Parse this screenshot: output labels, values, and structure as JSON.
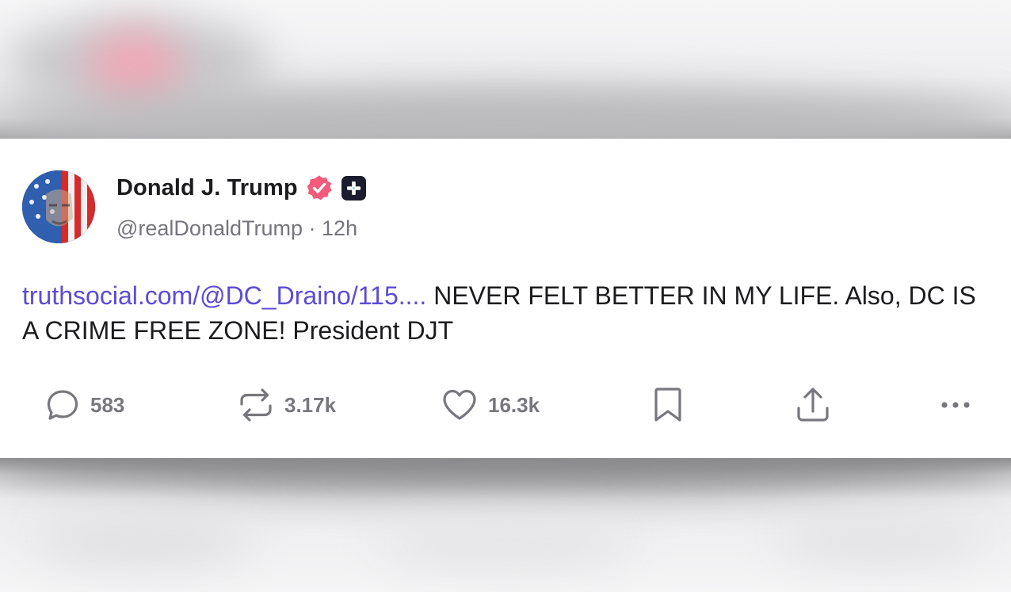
{
  "post": {
    "display_name": "Donald J. Trump",
    "handle": "@realDonaldTrump",
    "separator": "·",
    "time": "12h",
    "link_text": "truthsocial.com/@DC_Draino/115....",
    "body_text": " NEVER FELT BETTER IN MY LIFE. Also, DC IS A CRIME FREE ZONE! President DJT"
  },
  "actions": {
    "replies": "583",
    "reposts": "3.17k",
    "likes": "16.3k"
  },
  "colors": {
    "verified_badge": "#f45b7a",
    "link": "#5b4bd8",
    "plus_badge": "#1b1c2e"
  }
}
